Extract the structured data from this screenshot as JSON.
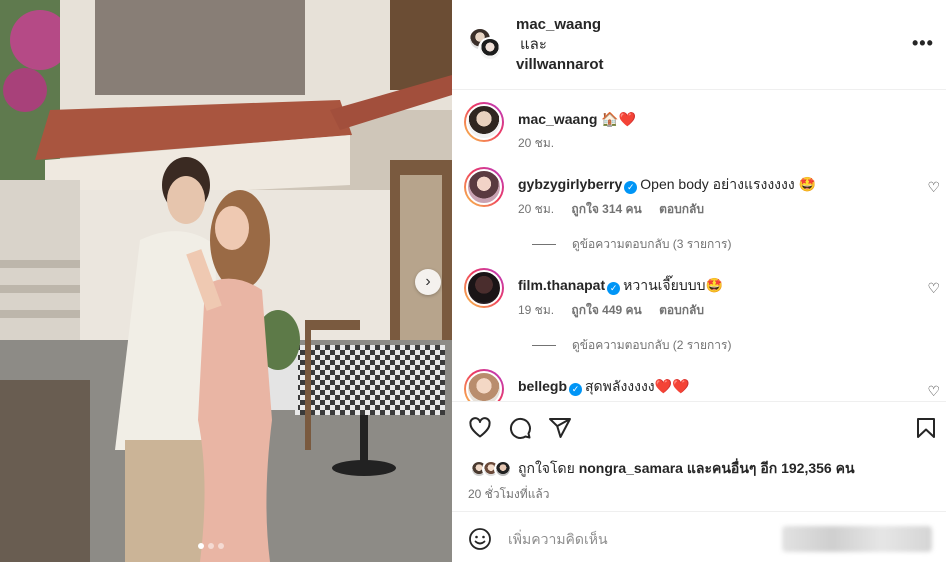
{
  "post": {
    "owner": "mac_waang",
    "and_text": "และ",
    "collaborator": "villwannarot"
  },
  "caption": {
    "username": "mac_waang",
    "text": "🏠❤️",
    "time": "20 ชม."
  },
  "comments": [
    {
      "username": "gybzygirlyberry",
      "verified": true,
      "text": "Open body อย่างแรงงงงง 🤩",
      "time": "20 ชม.",
      "likes": "ถูกใจ 314 คน",
      "reply": "ตอบกลับ",
      "view_replies": "ดูข้อความตอบกลับ (3 รายการ)"
    },
    {
      "username": "film.thanapat",
      "verified": true,
      "text": "หวานเจี๊ยบบบ🤩",
      "time": "19 ชม.",
      "likes": "ถูกใจ 449 คน",
      "reply": "ตอบกลับ",
      "view_replies": "ดูข้อความตอบกลับ (2 รายการ)"
    },
    {
      "username": "bellegb",
      "verified": true,
      "text": "สุดพลังงงงง❤️❤️",
      "time": "",
      "likes": "",
      "reply": "",
      "view_replies": ""
    }
  ],
  "likes_summary": {
    "prefix": "ถูกใจโดย",
    "user": "nongra_samara",
    "middle": "และคนอื่นๆ อีก",
    "count": "192,356",
    "suffix": "คน"
  },
  "time_ago": "20 ชั่วโมงที่แล้ว",
  "add_comment": {
    "placeholder": "เพิ่มความคิดเห็น"
  },
  "icons": [
    "more-icon",
    "heart-icon",
    "comment-icon",
    "share-icon",
    "bookmark-icon",
    "smile-icon",
    "next-arrow-icon"
  ],
  "carousel": {
    "slides": 3,
    "active": 1
  }
}
